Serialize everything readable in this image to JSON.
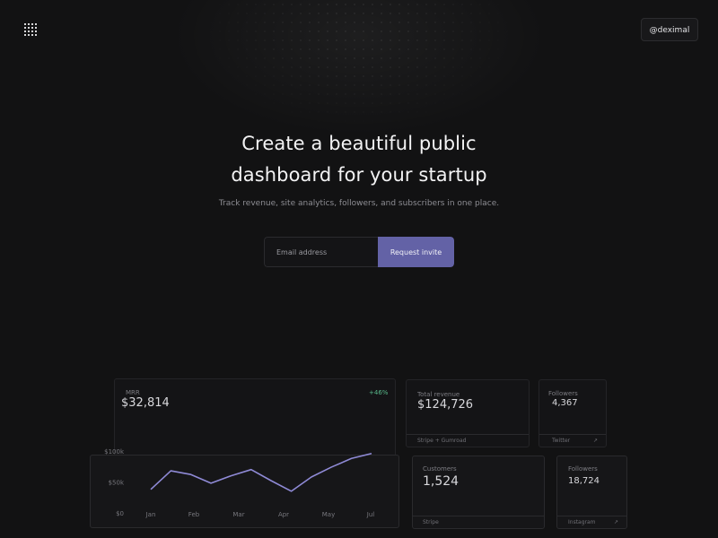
{
  "header": {
    "handle_label": "@deximal"
  },
  "hero": {
    "title_line1": "Create a beautiful public",
    "title_line2": "dashboard for your startup",
    "subtitle": "Track revenue, site analytics, followers, and subscribers in one place."
  },
  "form": {
    "email_placeholder": "Email address",
    "submit_label": "Request invite"
  },
  "cards": {
    "mrr": {
      "label": "MRR",
      "value": "$32,814",
      "change": "+46%"
    },
    "total_revenue": {
      "label": "Total revenue",
      "value": "$124,726",
      "footer": "Stripe + Gumroad"
    },
    "twitter": {
      "label": "Followers",
      "value": "4,367",
      "footer": "Twitter",
      "footer_icon": "arrow-icon"
    },
    "customers": {
      "label": "Customers",
      "value": "1,524",
      "footer": "Stripe"
    },
    "instagram": {
      "label": "Followers",
      "value": "18,724",
      "footer": "Instagram",
      "footer_icon": "arrow-icon"
    }
  },
  "chart_data": {
    "type": "line",
    "categories": [
      "Jan",
      "Feb",
      "Mar",
      "Apr",
      "May",
      "Jul"
    ],
    "x_ticks": [
      "Jan",
      "Feb",
      "Mar",
      "Apr",
      "May",
      "Jul"
    ],
    "y_ticks": [
      "$0",
      "$50k",
      "$100k"
    ],
    "ylim": [
      0,
      100000
    ],
    "series": [
      {
        "values": [
          38000,
          68000,
          62000,
          48000,
          60000,
          70000,
          52000,
          35000,
          58000,
          74000,
          88000,
          96000
        ],
        "color": "#8f8ad6"
      }
    ],
    "grid": false,
    "xlabel": "",
    "ylabel": ""
  },
  "colors": {
    "accent": "#6362a6",
    "positive": "#58b98a",
    "line": "#8f8ad6"
  }
}
